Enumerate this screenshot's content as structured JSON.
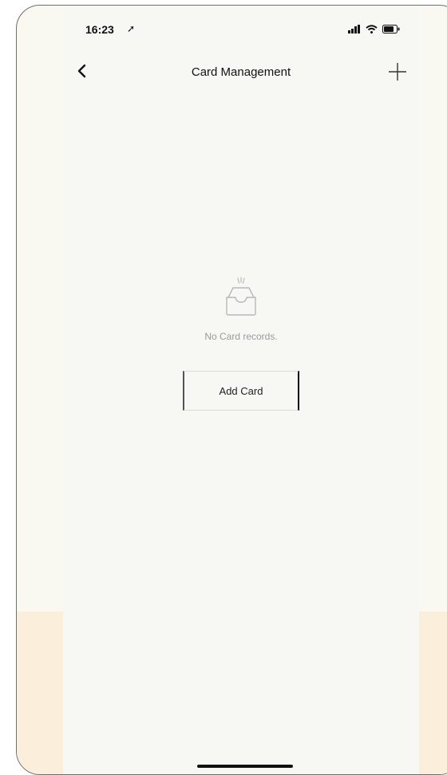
{
  "status_bar": {
    "time": "16:23",
    "location_glyph": "➚",
    "icons": [
      "signal-icon",
      "wifi-icon",
      "battery-icon"
    ]
  },
  "nav": {
    "title": "Card Management",
    "back_icon": "chevron-left-icon",
    "add_icon": "plus-icon"
  },
  "empty_state": {
    "icon": "empty-tray-icon",
    "message": "No Card records."
  },
  "actions": {
    "add_card_label": "Add Card"
  },
  "colors": {
    "background": "#f7f7f4",
    "watermark": "#fbeedb",
    "muted_text": "#9a9a9a"
  }
}
